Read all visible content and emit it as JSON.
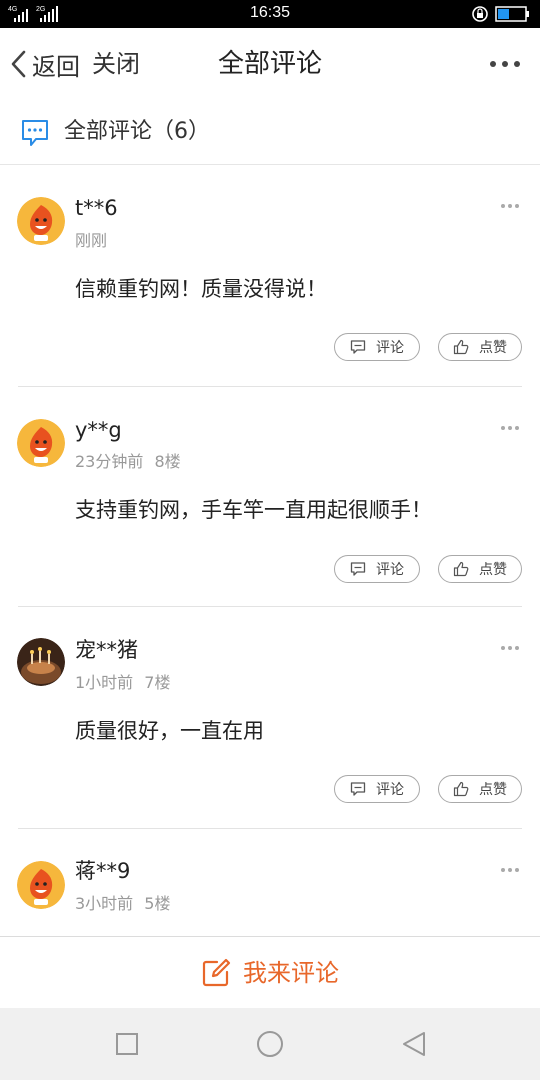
{
  "status_bar": {
    "time": "16:35",
    "network_1": "4G",
    "network_2": "2G"
  },
  "nav": {
    "back_label": "返回",
    "close_label": "关闭",
    "title": "全部评论"
  },
  "section": {
    "label": "全部评论（6）"
  },
  "comments": [
    {
      "user": "t**6",
      "time": "刚刚",
      "floor": "",
      "text": "信赖重钓网！质量没得说！",
      "comment_label": "评论",
      "like_label": "点赞"
    },
    {
      "user": "y**g",
      "time": "23分钟前",
      "floor": "8楼",
      "text": "支持重钓网，手车竿一直用起很顺手！",
      "comment_label": "评论",
      "like_label": "点赞"
    },
    {
      "user": "宠**猪",
      "time": "1小时前",
      "floor": "7楼",
      "text": "质量很好，一直在用",
      "comment_label": "评论",
      "like_label": "点赞"
    },
    {
      "user": "蒋**9",
      "time": "3小时前",
      "floor": "5楼",
      "text": "",
      "comment_label": "",
      "like_label": ""
    }
  ],
  "bottom": {
    "write_label": "我来评论"
  },
  "colors": {
    "accent": "#e8672a",
    "chat_icon": "#2a8ce6",
    "status_bar": "#000000"
  },
  "icons": [
    "back-chevron-icon",
    "more-icon",
    "chat-icon",
    "comment-icon",
    "thumbs-up-icon",
    "edit-icon",
    "overview-icon",
    "home-icon",
    "back-triangle-icon"
  ]
}
